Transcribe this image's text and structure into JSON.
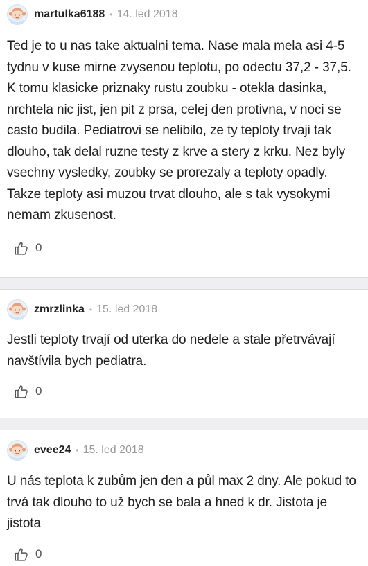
{
  "comments": [
    {
      "username": "martulka6188",
      "separator": "•",
      "date": "14. led 2018",
      "text": "Ted je to u nas take aktualni tema. Nase mala mela asi 4-5 tydnu v kuse mirne zvysenou teplotu, po odectu 37,2 - 37,5. K tomu klasicke priznaky rustu zoubku - otekla dasinka, nrchtela nic jist, jen pit z prsa, celej den protivna, v noci se casto budila. Pediatrovi se nelibilo, ze ty teploty trvaji tak dlouho, tak delal ruzne testy z krve a stery z krku. Nez byly vsechny vysledky, zoubky se prorezaly a teploty opadly. Takze teploty asi muzou trvat dlouho, ale s tak vysokymi nemam zkusenost.",
      "likes": "0"
    },
    {
      "username": "zmrzlinka",
      "separator": "•",
      "date": "15. led 2018",
      "text": "Jestli teploty trvají od uterka do nedele a stale přetrvávají navštívila bych pediatra.",
      "likes": "0"
    },
    {
      "username": "evee24",
      "separator": "•",
      "date": "15. led 2018",
      "text": "U nás teplota k zubům jen den a půl max 2 dny. Ale pokud to trvá tak dlouho to už bych se bala a hned k dr. Jistota je jistota",
      "likes": "0"
    }
  ],
  "icons": {
    "avatar": "baby-avatar-icon",
    "like": "thumbs-up-icon"
  },
  "colors": {
    "divider": "#efeff1",
    "date": "#9a9a9a",
    "avatar_face": "#f7d9c4",
    "avatar_hair": "#e9a07a",
    "avatar_bg": "#e7f1fa"
  }
}
